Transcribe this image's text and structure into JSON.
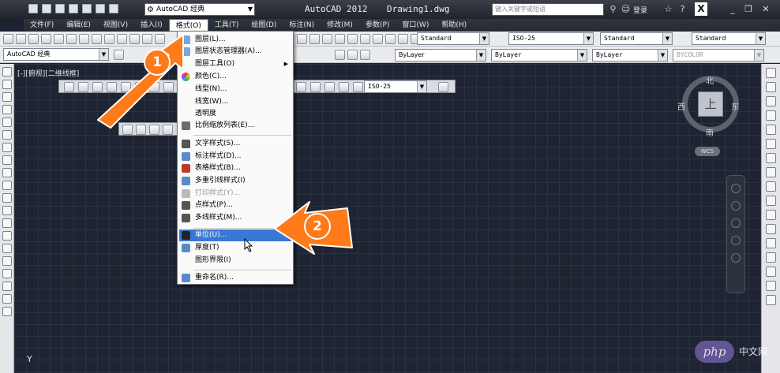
{
  "titlebar": {
    "workspace": "AutoCAD 经典",
    "app_title": "AutoCAD 2012",
    "doc_title": "Drawing1.dwg",
    "search_placeholder": "键入关键字或短语",
    "login": "登录"
  },
  "menubar": {
    "items": [
      "文件(F)",
      "编辑(E)",
      "视图(V)",
      "插入(I)",
      "格式(O)",
      "工具(T)",
      "绘图(D)",
      "标注(N)",
      "修改(M)",
      "参数(P)",
      "窗口(W)",
      "帮助(H)"
    ],
    "active_index": 4
  },
  "toolbar1": {
    "text_style": "Standard",
    "dim_style": "ISO-25",
    "table_style": "Standard",
    "mleader_style": "Standard"
  },
  "toolbar2": {
    "workspace": "AutoCAD 经典",
    "color": "ByLayer",
    "linetype": "ByLayer",
    "lineweight": "ByLayer",
    "plotstyle": "BYCOLOR"
  },
  "viewport_label": "[-][俯视][二维线框]",
  "dim_toolbar_combo": "ISO-25",
  "format_menu": {
    "items": [
      {
        "label": "图层(L)...",
        "icon_color": "#7aa6d8",
        "disabled": false
      },
      {
        "label": "图层状态管理器(A)...",
        "icon_color": "#7aa6d8",
        "disabled": false
      },
      {
        "label": "图层工具(O)",
        "icon_color": "",
        "disabled": false,
        "submenu": true
      },
      {
        "label": "颜色(C)...",
        "icon_color": "#d24a8c",
        "disabled": false
      },
      {
        "label": "线型(N)...",
        "icon_color": "",
        "disabled": false
      },
      {
        "label": "线宽(W)...",
        "icon_color": "",
        "disabled": false
      },
      {
        "label": "透明度",
        "icon_color": "",
        "disabled": false
      },
      {
        "label": "比例缩放列表(E)...",
        "icon_color": "#6d6d6d",
        "disabled": false
      },
      {
        "label": "文字样式(S)...",
        "icon_color": "#555",
        "disabled": false
      },
      {
        "label": "标注样式(D)...",
        "icon_color": "#5a8bc9",
        "disabled": false
      },
      {
        "label": "表格样式(B)...",
        "icon_color": "#c0392b",
        "disabled": false
      },
      {
        "label": "多重引线样式(I)",
        "icon_color": "#5a8bc9",
        "disabled": false
      },
      {
        "label": "打印样式(Y)...",
        "icon_color": "#bbb",
        "disabled": true
      },
      {
        "label": "点样式(P)...",
        "icon_color": "#555",
        "disabled": false
      },
      {
        "label": "多线样式(M)...",
        "icon_color": "#555",
        "disabled": false
      },
      {
        "label": "单位(U)...",
        "icon_color": "#222",
        "disabled": false,
        "highlight": true
      },
      {
        "label": "厚度(T)",
        "icon_color": "#5a8bc9",
        "disabled": false
      },
      {
        "label": "图形界限(I)",
        "icon_color": "",
        "disabled": false
      },
      {
        "label": "重命名(R)...",
        "icon_color": "#5a8bc9",
        "disabled": false
      }
    ]
  },
  "viewcube": {
    "face": "上",
    "north": "北",
    "south": "南",
    "east": "东",
    "west": "西",
    "wcs": "WCS"
  },
  "annotations": {
    "step1": "1",
    "step2": "2",
    "color": "#ff7a18"
  },
  "axis_label": "Y",
  "watermark": {
    "logo": "php",
    "text": "中文网"
  }
}
